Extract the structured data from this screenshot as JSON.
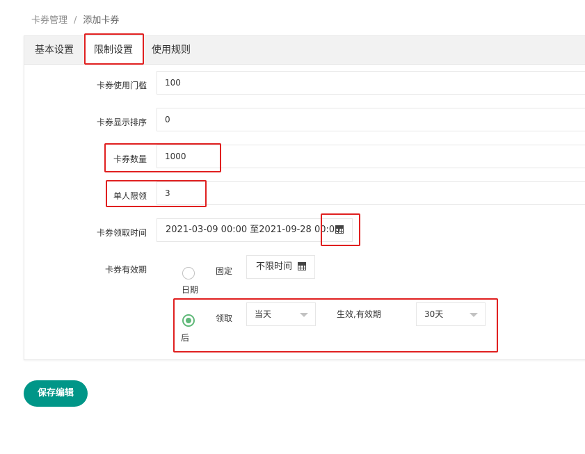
{
  "breadcrumb": {
    "parent": "卡券管理",
    "separator": "/",
    "current": "添加卡券"
  },
  "tabs": [
    {
      "label": "基本设置",
      "active": false
    },
    {
      "label": "限制设置",
      "active": true
    },
    {
      "label": "使用规则",
      "active": false
    }
  ],
  "form": {
    "threshold": {
      "label": "卡券使用门槛",
      "value": "100"
    },
    "sort": {
      "label": "卡券显示排序",
      "value": "0"
    },
    "quantity": {
      "label": "卡券数量",
      "value": "1000"
    },
    "per_user_limit": {
      "label": "单人限领",
      "value": "3"
    },
    "receive_time": {
      "label": "卡券领取时间",
      "value": "2021-03-09 00:00 至2021-09-28 00:00",
      "icon": "calendar-icon"
    },
    "validity": {
      "label": "卡券有效期",
      "fixed_option": {
        "text_right": "固定",
        "text_below": "日期",
        "checked": false,
        "value": "不限时间",
        "icon": "calendar-icon"
      },
      "after_option": {
        "text_right": "领取",
        "text_below": "后",
        "checked": true,
        "day_select": "当天",
        "effect_label": "生效,有效期",
        "duration_select": "30天"
      }
    }
  },
  "save_button": "保存编辑",
  "colors": {
    "primary": "#009688",
    "radio_checked": "#5fb878",
    "annotation_red": "#e02020",
    "tab_bg": "#f2f2f2",
    "border": "#e6e6e6"
  }
}
